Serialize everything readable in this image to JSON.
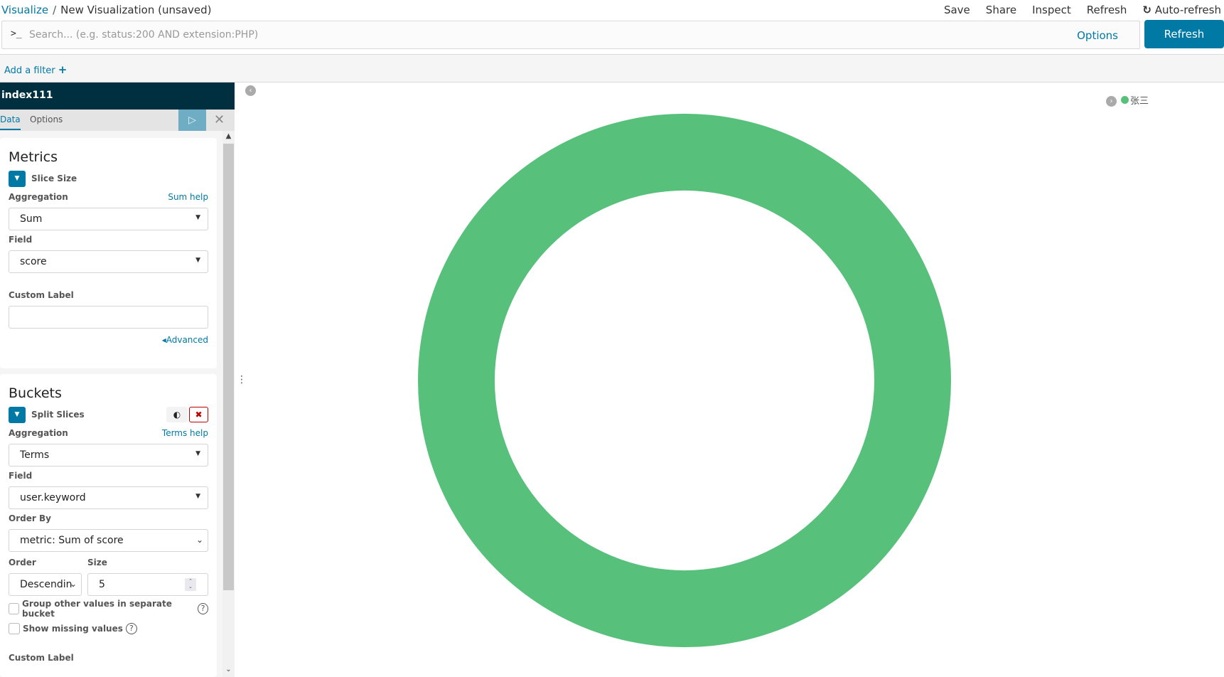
{
  "breadcrumb": {
    "root": "Visualize",
    "separator": "/",
    "current": "New Visualization (unsaved)"
  },
  "top_menu": [
    "Save",
    "Share",
    "Inspect",
    "Refresh",
    "Auto-refresh"
  ],
  "query": {
    "prompt": ">_",
    "placeholder": "Search... (e.g. status:200 AND extension:PHP)",
    "value": "",
    "options_label": "Options",
    "refresh_label": "Refresh"
  },
  "filter": {
    "add_label": "Add a filter",
    "add_icon": "+"
  },
  "sidebar": {
    "index_name": "index111",
    "tabs": [
      "Data",
      "Options"
    ],
    "active_tab": "Data",
    "apply_icon": "▷",
    "discard_icon": "✕",
    "metrics": {
      "title": "Metrics",
      "agg_title": "Slice Size",
      "aggregation_label": "Aggregation",
      "help_label": "Sum help",
      "aggregation_value": "Sum",
      "field_label": "Field",
      "field_value": "score",
      "custom_label": "Custom Label",
      "custom_value": "",
      "advanced_label": "◂Advanced"
    },
    "buckets": {
      "title": "Buckets",
      "agg_title": "Split Slices",
      "aggregation_label": "Aggregation",
      "help_label": "Terms help",
      "aggregation_value": "Terms",
      "field_label": "Field",
      "field_value": "user.keyword",
      "order_by_label": "Order By",
      "order_by_value": "metric: Sum of score",
      "order_label": "Order",
      "order_value": "Descendin",
      "size_label": "Size",
      "size_value": "5",
      "group_other_label": "Group other values in separate bucket",
      "group_other_checked": false,
      "show_missing_label": "Show missing values",
      "show_missing_checked": false,
      "custom_label": "Custom Label"
    }
  },
  "chart_data": {
    "type": "pie",
    "donut": true,
    "categories": [
      "张三"
    ],
    "values": [
      100
    ],
    "colors": [
      "#57c17b"
    ],
    "legend": {
      "position": "top-right",
      "entries": [
        "张三"
      ]
    },
    "title": ""
  }
}
